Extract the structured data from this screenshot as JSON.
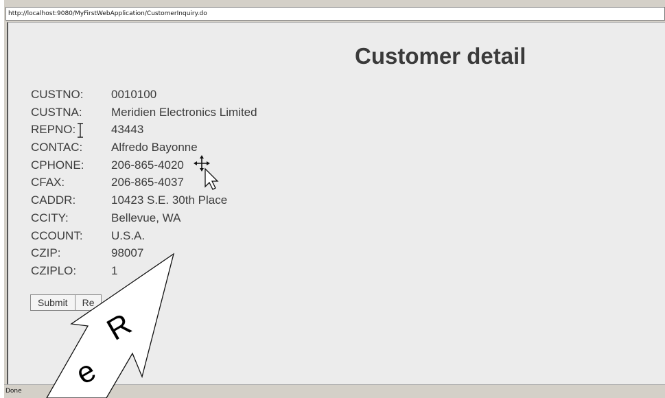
{
  "browser": {
    "address": "http://localhost:9080/MyFirstWebApplication/CustomerInquiry.do",
    "status": "Done"
  },
  "page": {
    "title": "Customer detail",
    "fields": [
      {
        "label": "CUSTNO:",
        "value": "0010100"
      },
      {
        "label": "CUSTNA:",
        "value": "Meridien Electronics Limited"
      },
      {
        "label": "REPNO:",
        "value": "43443"
      },
      {
        "label": "CONTAC:",
        "value": "Alfredo Bayonne"
      },
      {
        "label": "CPHONE:",
        "value": "206-865-4020"
      },
      {
        "label": "CFAX:",
        "value": "206-865-4037"
      },
      {
        "label": "CADDR:",
        "value": "10423 S.E. 30th Place"
      },
      {
        "label": "CCITY:",
        "value": "Bellevue, WA"
      },
      {
        "label": "CCOUNT:",
        "value": "U.S.A."
      },
      {
        "label": "CZIP:",
        "value": "98007"
      },
      {
        "label": "CZIPLO:",
        "value": "1"
      }
    ],
    "buttons": {
      "submit": "Submit",
      "reset": "Re"
    }
  },
  "annotation": {
    "letters": [
      "R",
      "e"
    ]
  },
  "icons": [
    "move-cursor-icon",
    "arrow-cursor-icon",
    "text-cursor-icon",
    "annotation-arrow-icon"
  ]
}
